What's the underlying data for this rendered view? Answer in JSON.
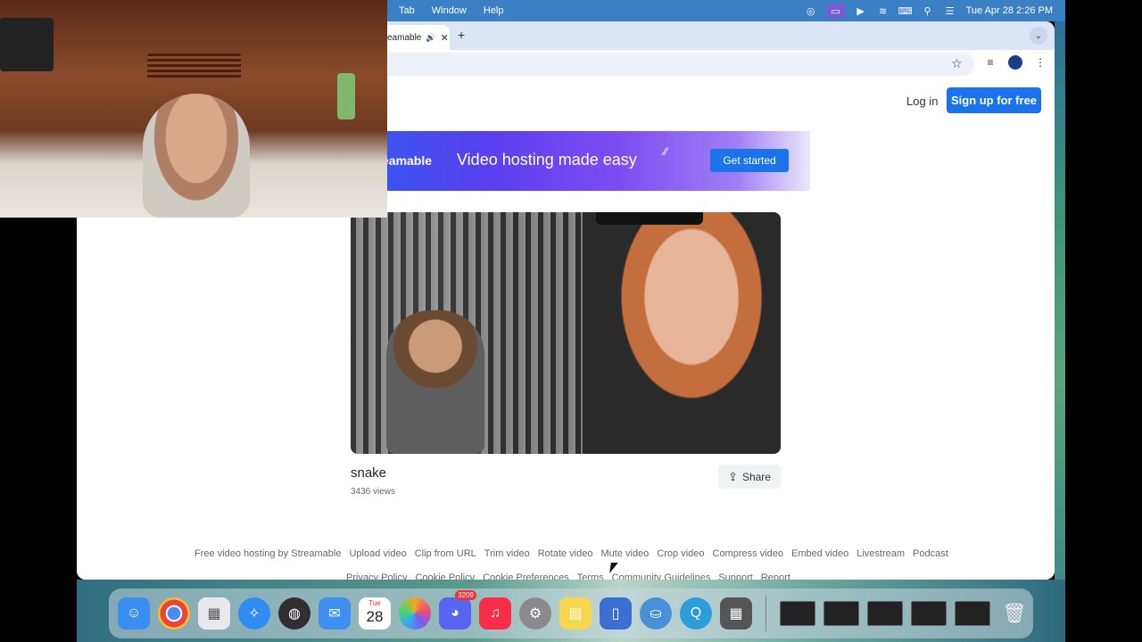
{
  "menubar": {
    "items": [
      "Tab",
      "Window",
      "Help"
    ],
    "clock": "Tue Apr 28  2:26 PM"
  },
  "browser": {
    "tab": {
      "title": "eamable"
    },
    "new_tab_symbol": "+",
    "tab_close_symbol": "✕"
  },
  "page": {
    "login": "Log in",
    "signup": "Sign up for free",
    "banner": {
      "brand": "eamable",
      "tagline": "Video hosting made easy",
      "cta": "Get started"
    },
    "video": {
      "title": "snake",
      "views": "3436 views",
      "share": "Share"
    },
    "footer_row1": [
      "Free video hosting by Streamable",
      "Upload video",
      "Clip from URL",
      "Trim video",
      "Rotate video",
      "Mute video",
      "Crop video",
      "Compress video",
      "Embed video",
      "Livestream",
      "Podcast"
    ],
    "footer_row2": [
      "Privacy Policy",
      "Cookie Policy",
      "Cookie Preferences",
      "Terms",
      "Community Guidelines",
      "Support",
      "Report"
    ]
  },
  "dock": {
    "discord_badge": "3209",
    "calendar_day": "Tue",
    "calendar_date": "28",
    "apps": [
      "finder-icon",
      "chrome-icon",
      "launchpad-icon",
      "safari-icon",
      "obs-icon",
      "mail-icon",
      "calendar-icon",
      "photos-icon",
      "discord-icon",
      "music-icon",
      "settings-icon",
      "notes-icon",
      "preview-icon",
      "app-icon",
      "quicktime-icon",
      "calculator-icon"
    ],
    "colors": {
      "finder": "#3a8ef0",
      "chrome": "#e8453c",
      "launchpad": "#e8e8ee",
      "safari": "#2f8cf0",
      "obs": "#302e31",
      "mail": "#3f8ef0",
      "photos": "#f5a623",
      "discord": "#5865f2",
      "music": "#fa2d48",
      "settings": "#8a8a8e",
      "notes": "#f8d64e",
      "preview": "#3b6fd1",
      "app": "#4a90d9",
      "quicktime": "#2d9cdb",
      "calculator": "#555555"
    }
  },
  "colors": {
    "accent": "#1a73e8",
    "menubar": "#3b7fc4"
  }
}
